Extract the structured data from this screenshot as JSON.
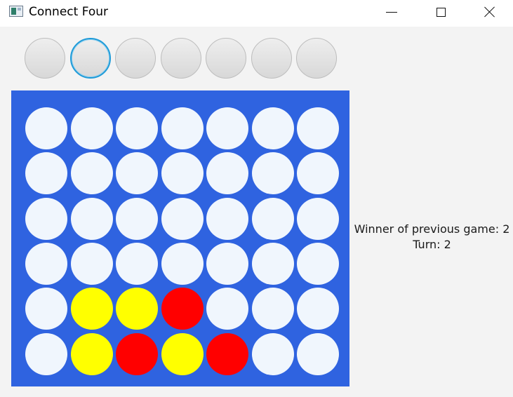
{
  "window": {
    "title": "Connect Four",
    "icon": "application-icon",
    "controls": [
      "minimize-icon",
      "maximize-icon",
      "close-icon"
    ]
  },
  "columns": 7,
  "rows": 6,
  "drop_buttons": {
    "count": 7,
    "focused_index": 1
  },
  "board": [
    [
      "empty",
      "empty",
      "empty",
      "empty",
      "empty",
      "empty",
      "empty"
    ],
    [
      "empty",
      "empty",
      "empty",
      "empty",
      "empty",
      "empty",
      "empty"
    ],
    [
      "empty",
      "empty",
      "empty",
      "empty",
      "empty",
      "empty",
      "empty"
    ],
    [
      "empty",
      "empty",
      "empty",
      "empty",
      "empty",
      "empty",
      "empty"
    ],
    [
      "empty",
      "yellow",
      "yellow",
      "red",
      "empty",
      "empty",
      "empty"
    ],
    [
      "empty",
      "yellow",
      "red",
      "yellow",
      "red",
      "empty",
      "empty"
    ]
  ],
  "colors": {
    "board": "#2f63e0",
    "empty": "#f0f6fd",
    "yellow": "#ffff00",
    "red": "#ff0000",
    "focus": "#1f9bd8"
  },
  "status": {
    "previous_winner": "Winner of previous game: 2",
    "turn": "Turn: 2"
  }
}
